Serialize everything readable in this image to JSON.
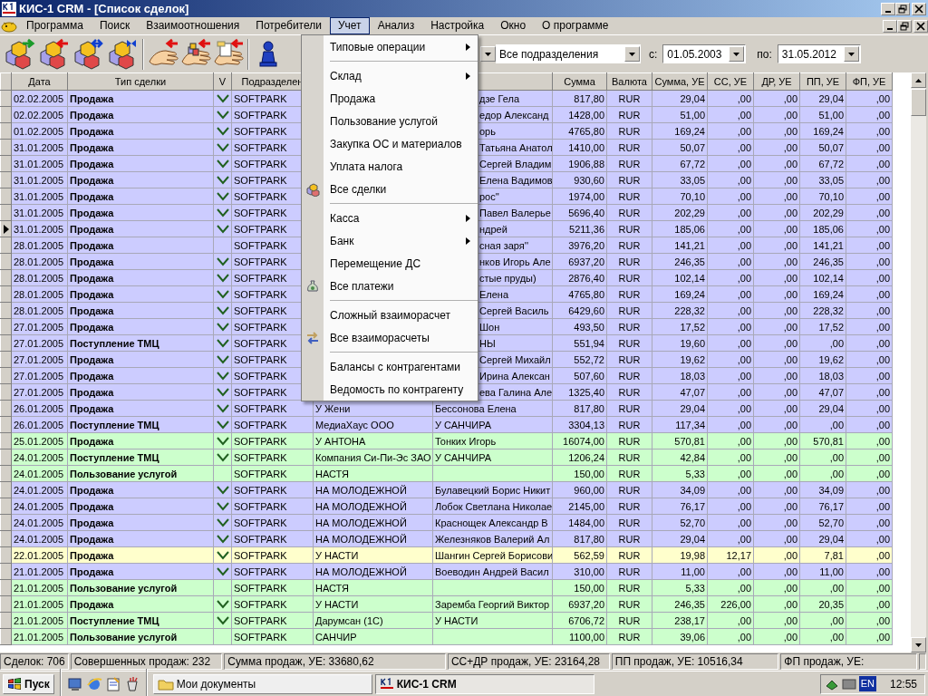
{
  "window": {
    "title": "КИС-1 CRM - [Список сделок]"
  },
  "menu_bar": [
    {
      "label": "Программа",
      "selected": false
    },
    {
      "label": "Поиск",
      "selected": false
    },
    {
      "label": "Взаимоотношения",
      "selected": false
    },
    {
      "label": "Потребители",
      "selected": false
    },
    {
      "label": "Учет",
      "selected": true
    },
    {
      "label": "Анализ",
      "selected": false
    },
    {
      "label": "Настройка",
      "selected": false
    },
    {
      "label": "Окно",
      "selected": false
    },
    {
      "label": "О программе",
      "selected": false
    }
  ],
  "filters": {
    "department": "Все подразделения",
    "from_label": "с:",
    "from": "01.05.2003",
    "to_label": "по:",
    "to": "31.05.2012"
  },
  "table": {
    "columns": [
      "Дата",
      "Тип сделки",
      "V",
      "Подразделен",
      null,
      null,
      "Сумма",
      "Валюта",
      "Сумма, УЕ",
      "СС, УЕ",
      "ДР, УЕ",
      "ПП, УЕ",
      "ФП, УЕ"
    ],
    "rows": [
      {
        "date": "02.02.2005",
        "type": "Продажа",
        "checked": true,
        "department": "SOFTPARK",
        "column_6": "дзе Гела",
        "sum": "817,80",
        "currency": "RUR",
        "sum_ue": "29,04",
        "ss_ue": ",00",
        "dr_ue": ",00",
        "pp_ue": "29,04",
        "fp_ue": ",00",
        "color": "#ccccff",
        "selected": false
      },
      {
        "date": "02.02.2005",
        "type": "Продажа",
        "checked": true,
        "department": "SOFTPARK",
        "column_6": "едор Александ",
        "sum": "1428,00",
        "currency": "RUR",
        "sum_ue": "51,00",
        "ss_ue": ",00",
        "dr_ue": ",00",
        "pp_ue": "51,00",
        "fp_ue": ",00",
        "color": "#ccccff",
        "selected": false
      },
      {
        "date": "01.02.2005",
        "type": "Продажа",
        "checked": true,
        "department": "SOFTPARK",
        "column_6": "орь",
        "sum": "4765,80",
        "currency": "RUR",
        "sum_ue": "169,24",
        "ss_ue": ",00",
        "dr_ue": ",00",
        "pp_ue": "169,24",
        "fp_ue": ",00",
        "color": "#ccccff",
        "selected": false
      },
      {
        "date": "31.01.2005",
        "type": "Продажа",
        "checked": true,
        "department": "SOFTPARK",
        "column_6": "Татьяна Анатол",
        "sum": "1410,00",
        "currency": "RUR",
        "sum_ue": "50,07",
        "ss_ue": ",00",
        "dr_ue": ",00",
        "pp_ue": "50,07",
        "fp_ue": ",00",
        "color": "#ccccff",
        "selected": false
      },
      {
        "date": "31.01.2005",
        "type": "Продажа",
        "checked": true,
        "department": "SOFTPARK",
        "column_6": "Сергей Владим",
        "sum": "1906,88",
        "currency": "RUR",
        "sum_ue": "67,72",
        "ss_ue": ",00",
        "dr_ue": ",00",
        "pp_ue": "67,72",
        "fp_ue": ",00",
        "color": "#ccccff",
        "selected": false
      },
      {
        "date": "31.01.2005",
        "type": "Продажа",
        "checked": true,
        "department": "SOFTPARK",
        "column_6": "Елена Вадимов",
        "sum": "930,60",
        "currency": "RUR",
        "sum_ue": "33,05",
        "ss_ue": ",00",
        "dr_ue": ",00",
        "pp_ue": "33,05",
        "fp_ue": ",00",
        "color": "#ccccff",
        "selected": false
      },
      {
        "date": "31.01.2005",
        "type": "Продажа",
        "checked": true,
        "department": "SOFTPARK",
        "column_6": "рос''",
        "sum": "1974,00",
        "currency": "RUR",
        "sum_ue": "70,10",
        "ss_ue": ",00",
        "dr_ue": ",00",
        "pp_ue": "70,10",
        "fp_ue": ",00",
        "color": "#ccccff",
        "selected": false
      },
      {
        "date": "31.01.2005",
        "type": "Продажа",
        "checked": true,
        "department": "SOFTPARK",
        "column_6": "Павел Валерье",
        "sum": "5696,40",
        "currency": "RUR",
        "sum_ue": "202,29",
        "ss_ue": ",00",
        "dr_ue": ",00",
        "pp_ue": "202,29",
        "fp_ue": ",00",
        "color": "#ccccff",
        "selected": false
      },
      {
        "date": "31.01.2005",
        "type": "Продажа",
        "checked": true,
        "department": "SOFTPARK",
        "column_6": "ндрей",
        "sum": "5211,36",
        "currency": "RUR",
        "sum_ue": "185,06",
        "ss_ue": ",00",
        "dr_ue": ",00",
        "pp_ue": "185,06",
        "fp_ue": ",00",
        "color": "#ccccff",
        "selected": true
      },
      {
        "date": "28.01.2005",
        "type": "Продажа",
        "checked": false,
        "department": "SOFTPARK",
        "column_6": "сная заря''",
        "sum": "3976,20",
        "currency": "RUR",
        "sum_ue": "141,21",
        "ss_ue": ",00",
        "dr_ue": ",00",
        "pp_ue": "141,21",
        "fp_ue": ",00",
        "color": "#ccccff",
        "selected": false
      },
      {
        "date": "28.01.2005",
        "type": "Продажа",
        "checked": true,
        "department": "SOFTPARK",
        "column_6": "нков Игорь Але",
        "sum": "6937,20",
        "currency": "RUR",
        "sum_ue": "246,35",
        "ss_ue": ",00",
        "dr_ue": ",00",
        "pp_ue": "246,35",
        "fp_ue": ",00",
        "color": "#ccccff",
        "selected": false
      },
      {
        "date": "28.01.2005",
        "type": "Продажа",
        "checked": true,
        "department": "SOFTPARK",
        "column_6": "стые пруды)",
        "sum": "2876,40",
        "currency": "RUR",
        "sum_ue": "102,14",
        "ss_ue": ",00",
        "dr_ue": ",00",
        "pp_ue": "102,14",
        "fp_ue": ",00",
        "color": "#ccccff",
        "selected": false
      },
      {
        "date": "28.01.2005",
        "type": "Продажа",
        "checked": true,
        "department": "SOFTPARK",
        "column_6": "Елена",
        "sum": "4765,80",
        "currency": "RUR",
        "sum_ue": "169,24",
        "ss_ue": ",00",
        "dr_ue": ",00",
        "pp_ue": "169,24",
        "fp_ue": ",00",
        "color": "#ccccff",
        "selected": false
      },
      {
        "date": "28.01.2005",
        "type": "Продажа",
        "checked": true,
        "department": "SOFTPARK",
        "column_6": "Сергей Василь",
        "sum": "6429,60",
        "currency": "RUR",
        "sum_ue": "228,32",
        "ss_ue": ",00",
        "dr_ue": ",00",
        "pp_ue": "228,32",
        "fp_ue": ",00",
        "color": "#ccccff",
        "selected": false
      },
      {
        "date": "27.01.2005",
        "type": "Продажа",
        "checked": true,
        "department": "SOFTPARK",
        "column_6": "Шон",
        "sum": "493,50",
        "currency": "RUR",
        "sum_ue": "17,52",
        "ss_ue": ",00",
        "dr_ue": ",00",
        "pp_ue": "17,52",
        "fp_ue": ",00",
        "color": "#ccccff",
        "selected": false
      },
      {
        "date": "27.01.2005",
        "type": "Поступление ТМЦ",
        "checked": true,
        "department": "SOFTPARK",
        "column_6": "НЫ",
        "sum": "551,94",
        "currency": "RUR",
        "sum_ue": "19,60",
        "ss_ue": ",00",
        "dr_ue": ",00",
        "pp_ue": ",00",
        "fp_ue": ",00",
        "color": "#ccccff",
        "selected": false
      },
      {
        "date": "27.01.2005",
        "type": "Продажа",
        "checked": true,
        "department": "SOFTPARK",
        "column_6": "Сергей Михайл",
        "sum": "552,72",
        "currency": "RUR",
        "sum_ue": "19,62",
        "ss_ue": ",00",
        "dr_ue": ",00",
        "pp_ue": "19,62",
        "fp_ue": ",00",
        "color": "#ccccff",
        "selected": false
      },
      {
        "date": "27.01.2005",
        "type": "Продажа",
        "checked": true,
        "department": "SOFTPARK",
        "column_6": "Ирина Алексан",
        "sum": "507,60",
        "currency": "RUR",
        "sum_ue": "18,03",
        "ss_ue": ",00",
        "dr_ue": ",00",
        "pp_ue": "18,03",
        "fp_ue": ",00",
        "color": "#ccccff",
        "selected": false
      },
      {
        "date": "27.01.2005",
        "type": "Продажа",
        "checked": true,
        "department": "SOFTPARK",
        "column_6": "ева Галина Але",
        "sum": "1325,40",
        "currency": "RUR",
        "sum_ue": "47,07",
        "ss_ue": ",00",
        "dr_ue": ",00",
        "pp_ue": "47,07",
        "fp_ue": ",00",
        "color": "#ccccff",
        "selected": false
      },
      {
        "date": "26.01.2005",
        "type": "Продажа",
        "checked": true,
        "department": "SOFTPARK",
        "column_5": "У Жени",
        "column_6": "Бессонова Елена",
        "sum": "817,80",
        "currency": "RUR",
        "sum_ue": "29,04",
        "ss_ue": ",00",
        "dr_ue": ",00",
        "pp_ue": "29,04",
        "fp_ue": ",00",
        "color": "#ccccff",
        "selected": false
      },
      {
        "date": "26.01.2005",
        "type": "Поступление ТМЦ",
        "checked": true,
        "department": "SOFTPARK",
        "column_5": "МедиаХаус ООО",
        "column_6": "У САНЧИРА",
        "sum": "3304,13",
        "currency": "RUR",
        "sum_ue": "117,34",
        "ss_ue": ",00",
        "dr_ue": ",00",
        "pp_ue": ",00",
        "fp_ue": ",00",
        "color": "#ccccff",
        "selected": false
      },
      {
        "date": "25.01.2005",
        "type": "Продажа",
        "checked": true,
        "department": "SOFTPARK",
        "column_5": "У АНТОНА",
        "column_6": "Тонких Игорь",
        "sum": "16074,00",
        "currency": "RUR",
        "sum_ue": "570,81",
        "ss_ue": ",00",
        "dr_ue": ",00",
        "pp_ue": "570,81",
        "fp_ue": ",00",
        "color": "#ccffcc",
        "selected": false
      },
      {
        "date": "24.01.2005",
        "type": "Поступление ТМЦ",
        "checked": true,
        "department": "SOFTPARK",
        "column_5": "Компания Си-Пи-Эс ЗАО",
        "column_6": "У САНЧИРА",
        "sum": "1206,24",
        "currency": "RUR",
        "sum_ue": "42,84",
        "ss_ue": ",00",
        "dr_ue": ",00",
        "pp_ue": ",00",
        "fp_ue": ",00",
        "color": "#ccffcc",
        "selected": false
      },
      {
        "date": "24.01.2005",
        "type": "Пользование услугой",
        "checked": false,
        "department": "SOFTPARK",
        "column_5": "НАСТЯ",
        "sum": "150,00",
        "currency": "RUR",
        "sum_ue": "5,33",
        "ss_ue": ",00",
        "dr_ue": ",00",
        "pp_ue": ",00",
        "fp_ue": ",00",
        "color": "#ccffcc",
        "selected": false
      },
      {
        "date": "24.01.2005",
        "type": "Продажа",
        "checked": true,
        "department": "SOFTPARK",
        "column_5": "НА МОЛОДЕЖНОЙ",
        "column_6": "Булавецкий Борис Никит",
        "sum": "960,00",
        "currency": "RUR",
        "sum_ue": "34,09",
        "ss_ue": ",00",
        "dr_ue": ",00",
        "pp_ue": "34,09",
        "fp_ue": ",00",
        "color": "#ccccff",
        "selected": false
      },
      {
        "date": "24.01.2005",
        "type": "Продажа",
        "checked": true,
        "department": "SOFTPARK",
        "column_5": "НА МОЛОДЕЖНОЙ",
        "column_6": "Лобок Светлана Николае",
        "sum": "2145,00",
        "currency": "RUR",
        "sum_ue": "76,17",
        "ss_ue": ",00",
        "dr_ue": ",00",
        "pp_ue": "76,17",
        "fp_ue": ",00",
        "color": "#ccccff",
        "selected": false
      },
      {
        "date": "24.01.2005",
        "type": "Продажа",
        "checked": true,
        "department": "SOFTPARK",
        "column_5": "НА МОЛОДЕЖНОЙ",
        "column_6": "Краснощек Александр В",
        "sum": "1484,00",
        "currency": "RUR",
        "sum_ue": "52,70",
        "ss_ue": ",00",
        "dr_ue": ",00",
        "pp_ue": "52,70",
        "fp_ue": ",00",
        "color": "#ccccff",
        "selected": false
      },
      {
        "date": "24.01.2005",
        "type": "Продажа",
        "checked": true,
        "department": "SOFTPARK",
        "column_5": "НА МОЛОДЕЖНОЙ",
        "column_6": "Железняков Валерий Ал",
        "sum": "817,80",
        "currency": "RUR",
        "sum_ue": "29,04",
        "ss_ue": ",00",
        "dr_ue": ",00",
        "pp_ue": "29,04",
        "fp_ue": ",00",
        "color": "#ccccff",
        "selected": false
      },
      {
        "date": "22.01.2005",
        "type": "Продажа",
        "checked": true,
        "department": "SOFTPARK",
        "column_5": "У НАСТИ",
        "column_6": "Шангин Сергей Борисови",
        "sum": "562,59",
        "currency": "RUR",
        "sum_ue": "19,98",
        "ss_ue": "12,17",
        "dr_ue": ",00",
        "pp_ue": "7,81",
        "fp_ue": ",00",
        "color": "#ffffcc",
        "selected": false
      },
      {
        "date": "21.01.2005",
        "type": "Продажа",
        "checked": true,
        "department": "SOFTPARK",
        "column_5": "НА МОЛОДЕЖНОЙ",
        "column_6": "Воеводин Андрей Васил",
        "sum": "310,00",
        "currency": "RUR",
        "sum_ue": "11,00",
        "ss_ue": ",00",
        "dr_ue": ",00",
        "pp_ue": "11,00",
        "fp_ue": ",00",
        "color": "#ccccff",
        "selected": false
      },
      {
        "date": "21.01.2005",
        "type": "Пользование услугой",
        "checked": false,
        "department": "SOFTPARK",
        "column_5": "НАСТЯ",
        "sum": "150,00",
        "currency": "RUR",
        "sum_ue": "5,33",
        "ss_ue": ",00",
        "dr_ue": ",00",
        "pp_ue": ",00",
        "fp_ue": ",00",
        "color": "#ccffcc",
        "selected": false
      },
      {
        "date": "21.01.2005",
        "type": "Продажа",
        "checked": true,
        "department": "SOFTPARK",
        "column_5": "У НАСТИ",
        "column_6": "Заремба Георгий Виктор",
        "sum": "6937,20",
        "currency": "RUR",
        "sum_ue": "246,35",
        "ss_ue": "226,00",
        "dr_ue": ",00",
        "pp_ue": "20,35",
        "fp_ue": ",00",
        "color": "#ccffcc",
        "selected": false
      },
      {
        "date": "21.01.2005",
        "type": "Поступление ТМЦ",
        "checked": true,
        "department": "SOFTPARK",
        "column_5": "Дарумсан (1С)",
        "column_6": "У НАСТИ",
        "sum": "6706,72",
        "currency": "RUR",
        "sum_ue": "238,17",
        "ss_ue": ",00",
        "dr_ue": ",00",
        "pp_ue": ",00",
        "fp_ue": ",00",
        "color": "#ccffcc",
        "selected": false
      },
      {
        "date": "21.01.2005",
        "type": "Пользование услугой",
        "checked": false,
        "department": "SOFTPARK",
        "column_5": "САНЧИР",
        "sum": "1100,00",
        "currency": "RUR",
        "sum_ue": "39,06",
        "ss_ue": ",00",
        "dr_ue": ",00",
        "pp_ue": ",00",
        "fp_ue": ",00",
        "color": "#ccffcc",
        "selected": false
      }
    ]
  },
  "dropdown_menu": [
    {
      "kind": "item",
      "label": "Типовые операции",
      "submenu": true
    },
    {
      "kind": "separator"
    },
    {
      "kind": "item",
      "label": "Склад",
      "submenu": true
    },
    {
      "kind": "item",
      "label": "Продажа",
      "submenu": false
    },
    {
      "kind": "item",
      "label": "Пользование услугой",
      "submenu": false
    },
    {
      "kind": "item",
      "label": "Закупка ОС и материалов",
      "submenu": false
    },
    {
      "kind": "item",
      "label": "Уплата налога",
      "submenu": false
    },
    {
      "kind": "icon-item",
      "label": "Все сделки",
      "submenu": false
    },
    {
      "kind": "separator"
    },
    {
      "kind": "item",
      "label": "Касса",
      "submenu": true
    },
    {
      "kind": "item",
      "label": "Банк",
      "submenu": true
    },
    {
      "kind": "item",
      "label": "Перемещение ДС",
      "submenu": false
    },
    {
      "kind": "icon-item",
      "label": "Все платежи",
      "submenu": false
    },
    {
      "kind": "separator"
    },
    {
      "kind": "item",
      "label": "Сложный взаиморасчет",
      "submenu": false
    },
    {
      "kind": "icon-item",
      "label": "Все взаиморасчеты",
      "submenu": false
    },
    {
      "kind": "separator"
    },
    {
      "kind": "item",
      "label": "Балансы с контрагентами",
      "submenu": false
    },
    {
      "kind": "item",
      "label": "Ведомость по контрагенту",
      "submenu": false
    }
  ],
  "status_bar": [
    "Сделок: 706",
    "Совершенных продаж: 232",
    "Сумма продаж, УЕ: 33680,62",
    "СС+ДР продаж, УЕ: 23164,28",
    "ПП продаж, УЕ: 10516,34",
    "ФП продаж, УЕ:"
  ],
  "taskbar": {
    "start": "Пуск",
    "tasks": [
      {
        "label": "Мои документы",
        "selected": false
      },
      {
        "label": "КИС-1 CRM",
        "selected": true
      }
    ],
    "language": "EN",
    "clock": "12:55"
  }
}
